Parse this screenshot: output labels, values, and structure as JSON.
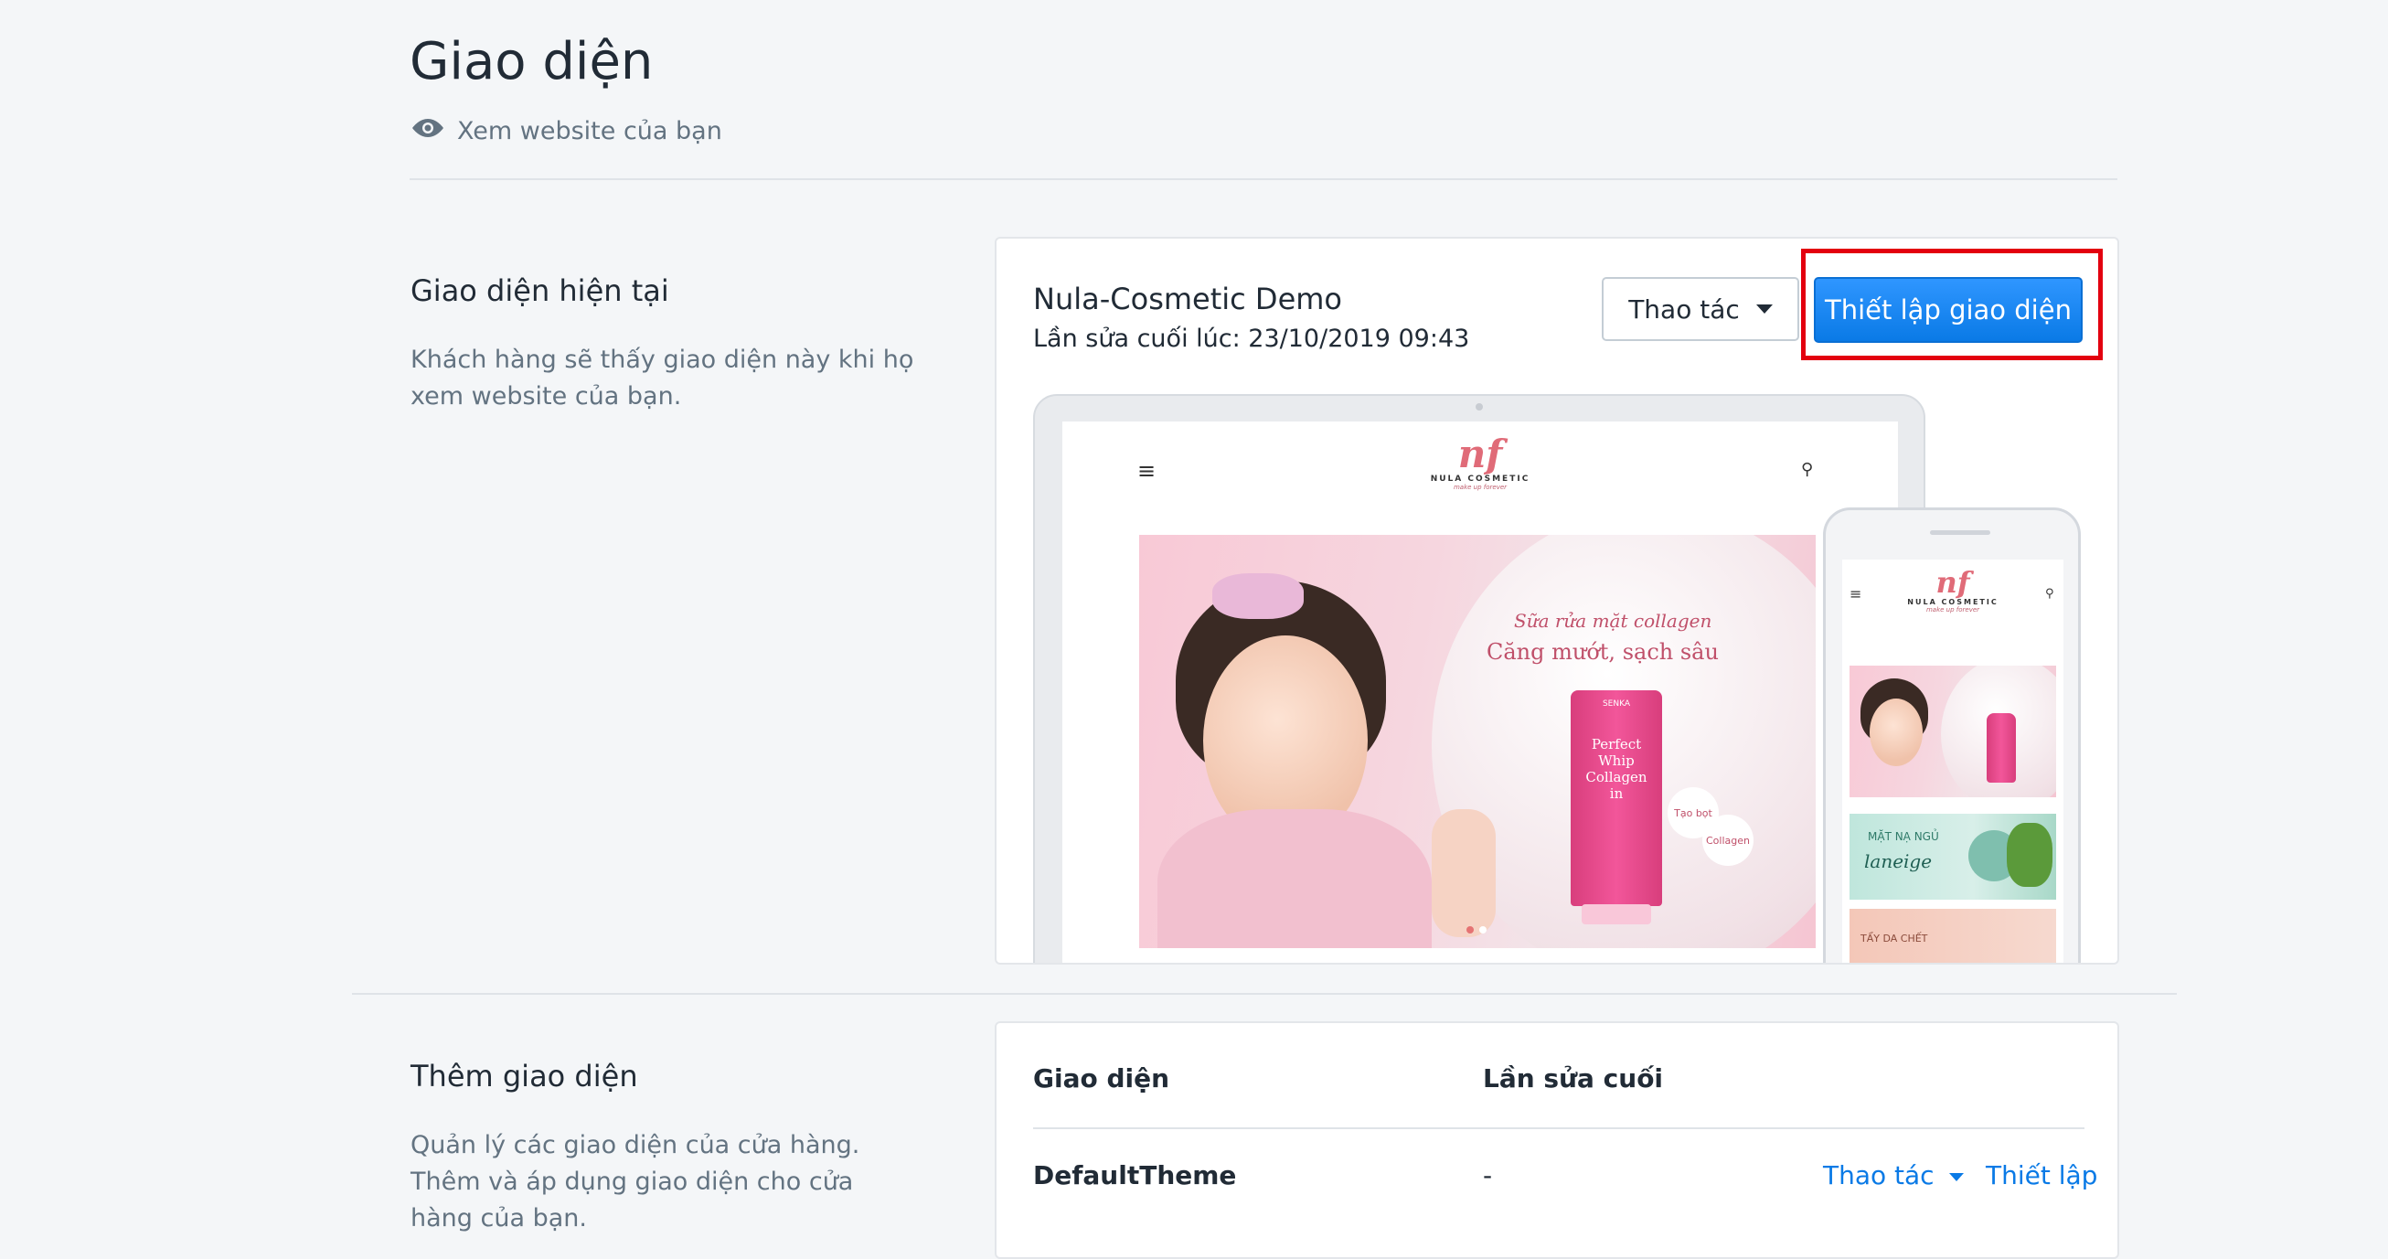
{
  "header": {
    "title": "Giao diện",
    "view_site": "Xem website của bạn"
  },
  "current_theme": {
    "section_title": "Giao diện hiện tại",
    "section_desc": "Khách hàng sẽ thấy giao diện này khi họ xem website của bạn.",
    "theme_name": "Nula-Cosmetic Demo",
    "last_edited": "Lần sửa cuối lúc: 23/10/2019 09:43",
    "actions_label": "Thao tác",
    "setup_label": "Thiết lập giao diện",
    "preview": {
      "logo_mark": "nf",
      "logo_name": "NULA COSMETIC",
      "logo_tagline": "make up forever",
      "banner_line1": "Sữa rửa mặt collagen",
      "banner_line2": "Căng mướt, sạch sâu",
      "product_text": "Perfect Whip Collagen in",
      "product_brand": "SENKA",
      "bubble1": "Tạo bọt",
      "bubble2": "Collagen",
      "mini_banner2_line1": "MẶT NẠ NGỦ",
      "mini_banner2_line2": "laneige",
      "mini_banner3": "TẨY DA CHẾT"
    }
  },
  "add_theme": {
    "section_title": "Thêm giao diện",
    "section_desc": "Quản lý các giao diện của cửa hàng. Thêm và áp dụng giao diện cho cửa hàng của bạn.",
    "columns": [
      "Giao diện",
      "Lần sửa cuối"
    ],
    "rows": [
      {
        "name": "DefaultTheme",
        "last_edited": "-",
        "actions_label": "Thao tác",
        "setup_label": "Thiết lập"
      }
    ]
  },
  "colors": {
    "primary": "#0a7ae6",
    "highlight_box": "#e3000f",
    "background": "#f4f6f8"
  }
}
